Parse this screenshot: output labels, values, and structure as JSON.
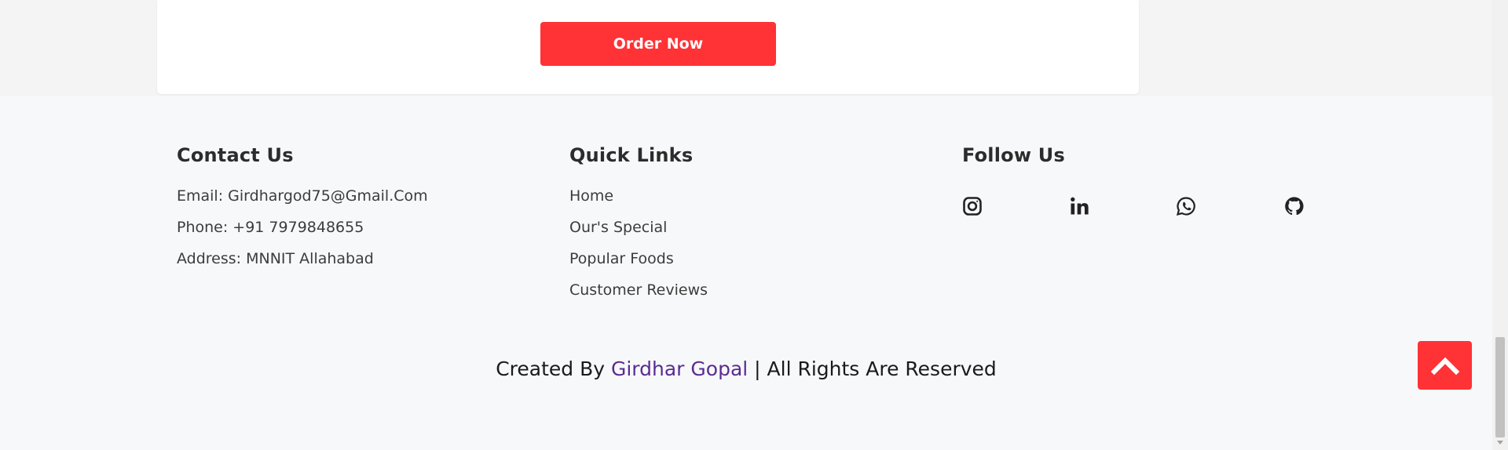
{
  "card": {
    "order_button_label": "Order Now"
  },
  "footer": {
    "contact": {
      "heading": "Contact Us",
      "email": "Email: Girdhargod75@Gmail.Com",
      "phone": "Phone: +91 7979848655",
      "address": "Address: MNNIT Allahabad"
    },
    "quick_links": {
      "heading": "Quick Links",
      "items": [
        "Home",
        "Our's Special",
        "Popular Foods",
        "Customer Reviews"
      ]
    },
    "follow": {
      "heading": "Follow Us",
      "icons": [
        "instagram-icon",
        "linkedin-icon",
        "whatsapp-icon",
        "github-icon"
      ]
    },
    "credit": {
      "prefix": "Created By ",
      "author": "Girdhar Gopal",
      "suffix": " | All Rights Are Reserved"
    }
  },
  "scroll_top": {
    "icon": "chevron-up-icon"
  },
  "colors": {
    "accent": "#ff3236",
    "author_link": "#5a2d91",
    "footer_bg": "#f7f8fa",
    "page_bg": "#f4f4f4"
  }
}
